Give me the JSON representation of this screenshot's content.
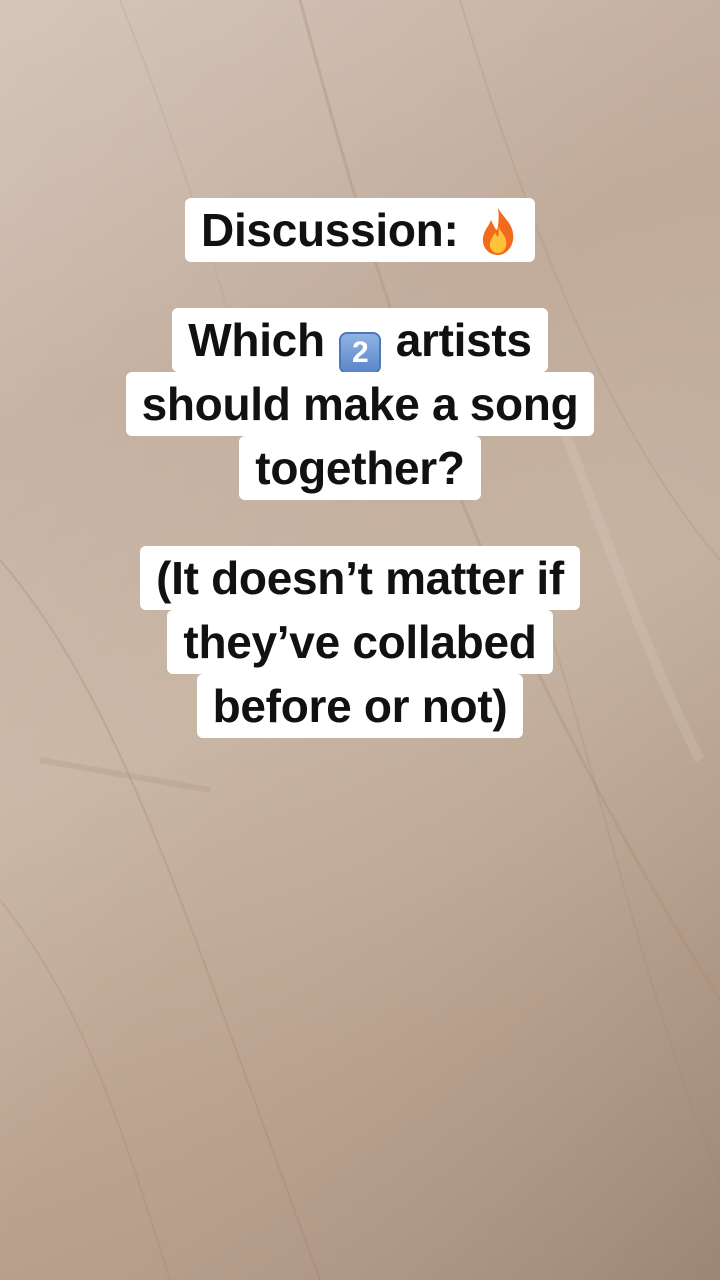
{
  "captions": {
    "line1_text": "Discussion:",
    "line1_icon": "fire-emoji",
    "q_line1_before": "Which",
    "q_line1_keycap": "2",
    "q_line1_after": "artists",
    "q_line2": "should make a song",
    "q_line3": "together?",
    "n_line1": "(It doesn’t matter if",
    "n_line2": "they’ve collabed",
    "n_line3": "before or not)"
  },
  "colors": {
    "caption_bg": "#ffffff",
    "caption_text": "#111111",
    "keycap": "#6f98d6",
    "background": "#c2ad9b"
  }
}
